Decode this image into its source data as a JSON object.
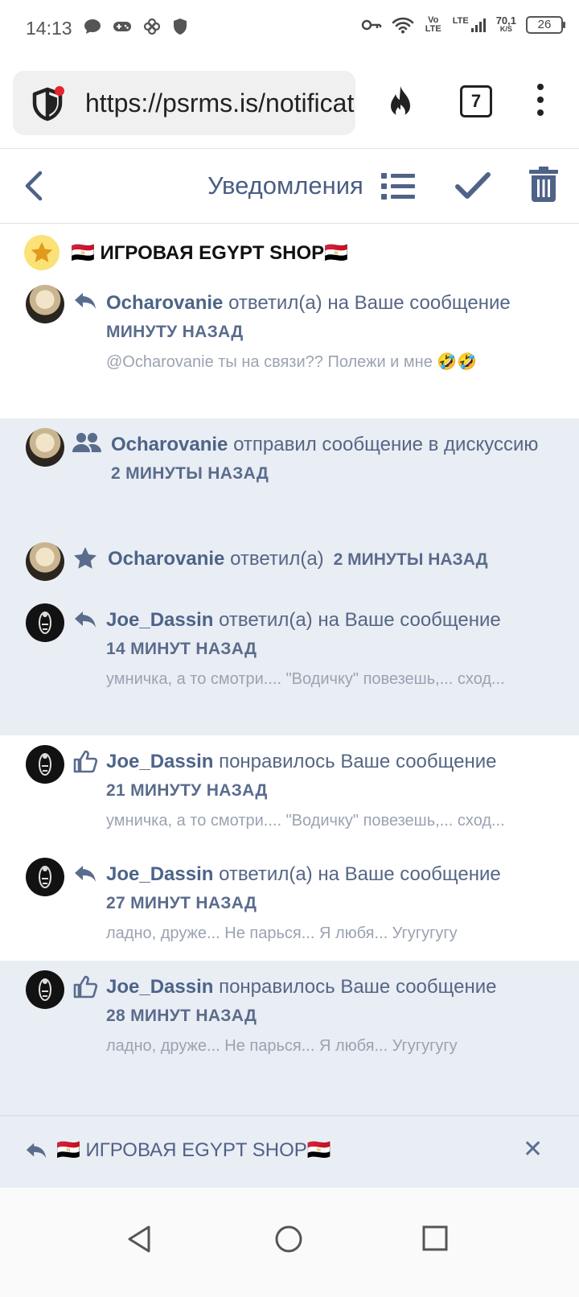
{
  "status_bar": {
    "time": "14:13",
    "network": "LTE",
    "volte": "Vo LTE",
    "speed_value": "70,1",
    "speed_unit": "K/S",
    "battery": "26"
  },
  "browser": {
    "url": "https://psrms.is/notifications",
    "tab_count": "7"
  },
  "header": {
    "title": "Уведомления"
  },
  "group": {
    "title": "🇪🇬 ИГРОВАЯ EGYPT SHOP🇪🇬"
  },
  "notifications": [
    {
      "user": "Ocharovanie",
      "action": " ответил(а) на Ваше сообщение",
      "time": "МИНУТУ НАЗАД",
      "snippet": "@Ocharovanie ты на связи?? Полежи и мне 🤣🤣",
      "icon": "reply-icon",
      "unread": false
    },
    {
      "user": "Ocharovanie",
      "action": " отправил сообщение в дискуссию",
      "time": "2 МИНУТЫ НАЗАД",
      "snippet": "",
      "icon": "users-icon",
      "unread": true
    },
    {
      "user": "Ocharovanie",
      "action": " ответил(а)",
      "time": "2 МИНУТЫ НАЗАД",
      "snippet": "",
      "icon": "star-icon",
      "unread": true
    },
    {
      "user": "Joe_Dassin",
      "action": " ответил(а) на Ваше сообщение",
      "time": "14 МИНУТ НАЗАД",
      "snippet": "умничка, а то смотри.... \"Водичку\" повезешь,... сход...",
      "icon": "reply-icon",
      "unread": true
    },
    {
      "user": "Joe_Dassin",
      "action": " понравилось Ваше сообщение",
      "time": "21 МИНУТУ НАЗАД",
      "snippet": "умничка, а то смотри.... \"Водичку\" повезешь,... сход...",
      "icon": "thumbs-up-icon",
      "unread": false
    },
    {
      "user": "Joe_Dassin",
      "action": " ответил(а) на Ваше сообщение",
      "time": "27 МИНУТ НАЗАД",
      "snippet": "ладно, друже... Не парься... Я любя... Угугугугу",
      "icon": "reply-icon",
      "unread": false
    },
    {
      "user": "Joe_Dassin",
      "action": " понравилось Ваше сообщение",
      "time": "28 МИНУТ НАЗАД",
      "snippet": "ладно, друже... Не парься... Я любя... Угугугугу",
      "icon": "thumbs-up-icon",
      "unread": true
    }
  ],
  "reply_bar": {
    "text": "🇪🇬 ИГРОВАЯ EGYPT SHOP🇪🇬",
    "close": "✕"
  },
  "colors": {
    "accent": "#4d6488",
    "unread_bg": "#e9edf4",
    "muted_text": "#9ba3b1"
  }
}
